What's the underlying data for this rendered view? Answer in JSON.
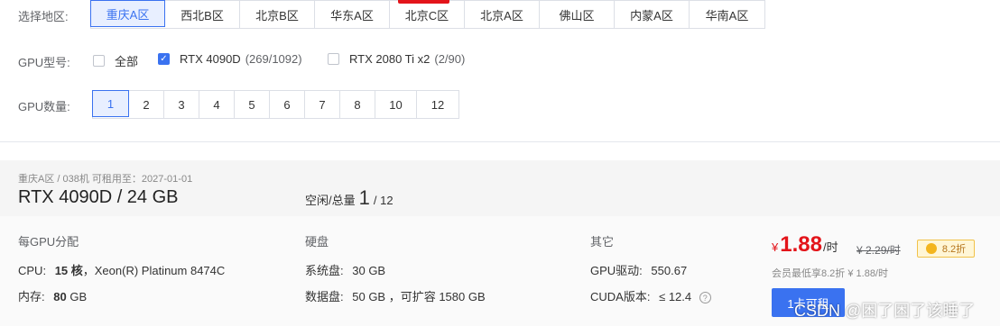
{
  "filters": {
    "region_label": "选择地区:",
    "regions": [
      "重庆A区",
      "西北B区",
      "北京B区",
      "华东A区",
      "北京C区",
      "北京A区",
      "佛山区",
      "内蒙A区",
      "华南A区"
    ],
    "gpu_type_label": "GPU型号:",
    "gpu_types": [
      {
        "name": "全部",
        "count": "",
        "checked": false
      },
      {
        "name": "RTX 4090D",
        "count": "(269/1092)",
        "checked": true
      },
      {
        "name": "RTX 2080 Ti x2",
        "count": "(2/90)",
        "checked": false
      }
    ],
    "gpu_count_label": "GPU数量:",
    "gpu_counts": [
      "1",
      "2",
      "3",
      "4",
      "5",
      "6",
      "7",
      "8",
      "10",
      "12"
    ]
  },
  "machine": {
    "meta": "重庆A区 / 038机   可租用至：2027-01-01",
    "name": "RTX 4090D / 24 GB",
    "idle_label": "空闲/总量",
    "idle": "1",
    "total": "/ 12",
    "per_gpu": {
      "title": "每GPU分配",
      "cpu_label": "CPU:",
      "cpu_cores": "15 核",
      "cpu_model": "，Xeon(R) Platinum 8474C",
      "mem_label": "内存:",
      "mem_value": "80",
      "mem_unit": "GB"
    },
    "disk": {
      "title": "硬盘",
      "sys_label": "系统盘:",
      "sys_value": "30 GB",
      "data_label": "数据盘:",
      "data_value": "50 GB ，可扩容 1580 GB"
    },
    "other": {
      "title": "其它",
      "driver_label": "GPU驱动:",
      "driver_value": "550.67",
      "cuda_label": "CUDA版本:",
      "cuda_value": "≤ 12.4"
    },
    "price": {
      "currency": "¥",
      "value": "1.88",
      "unit": "/时",
      "original": "¥ 2.29/时",
      "discount": "8.2折",
      "member": "会员最低享8.2折 ¥ 1.88/时"
    },
    "rent_button": "1卡可租"
  },
  "watermark": "CSDN @困了困了该睡了",
  "colors": {
    "accent": "#3a72f0",
    "price": "#e3141a",
    "active_bg": "#e8efff"
  }
}
